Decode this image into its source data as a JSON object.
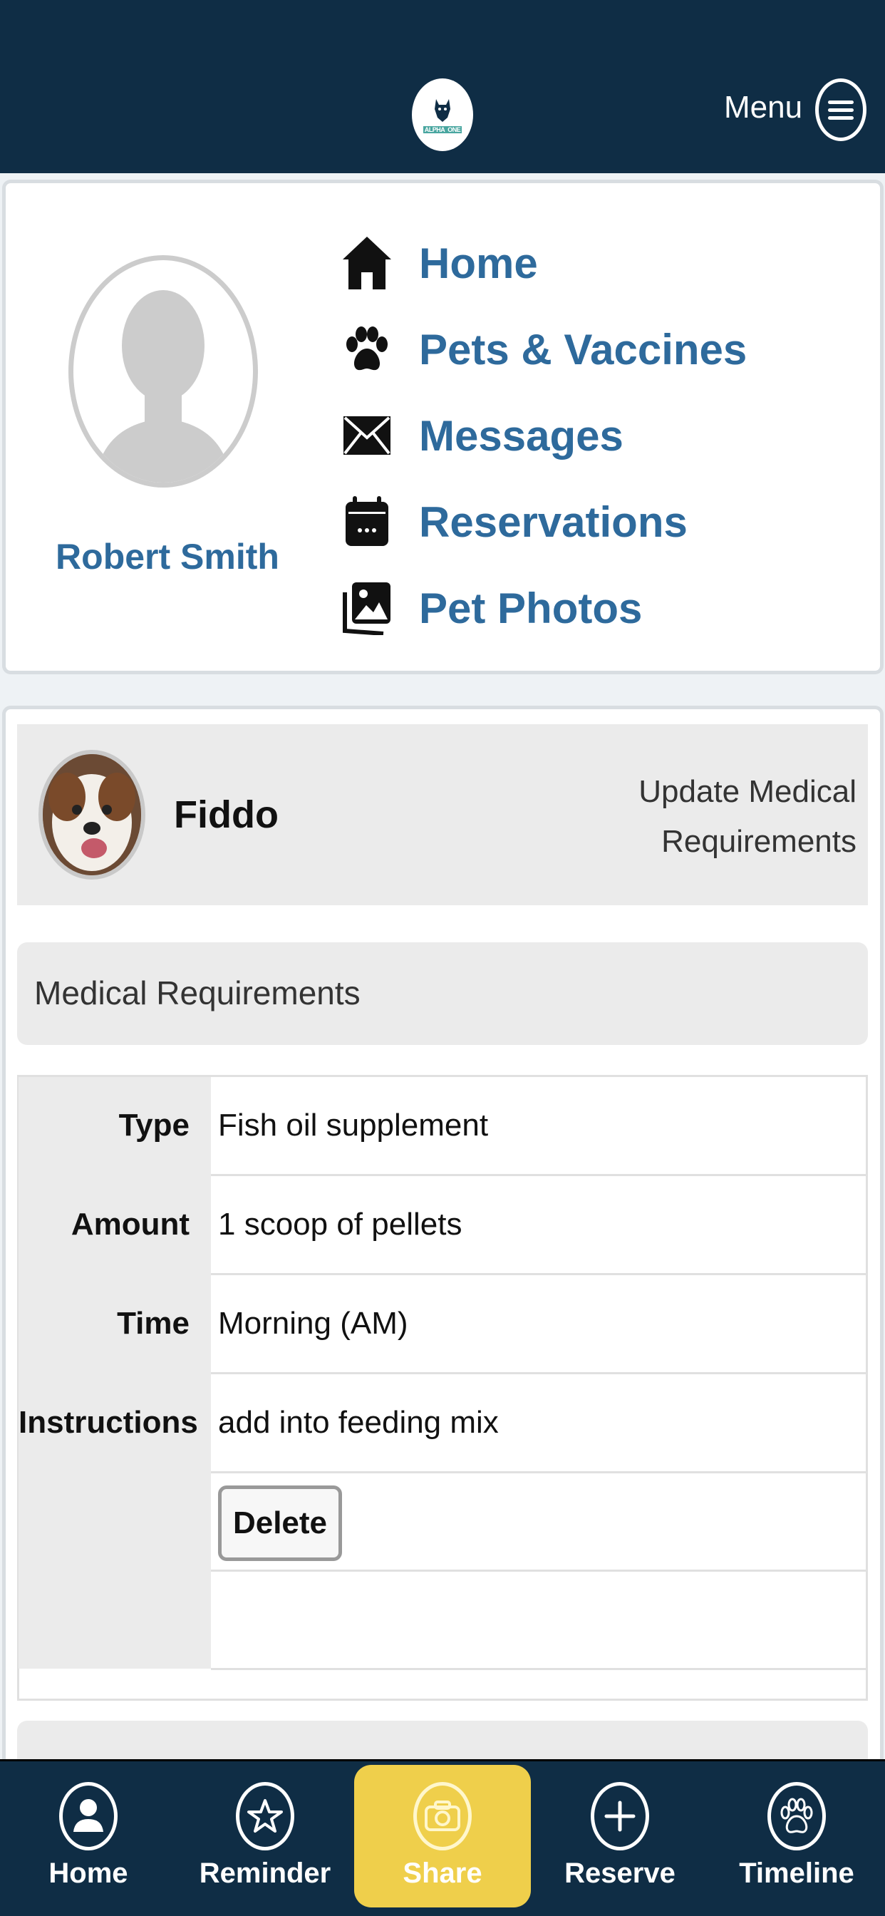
{
  "header": {
    "logo_text": "ALPHA",
    "logo_badge": "ONE",
    "menu_label": "Menu"
  },
  "profile": {
    "name": "Robert Smith"
  },
  "nav_menu": [
    {
      "label": "Home",
      "icon": "home-icon"
    },
    {
      "label": "Pets & Vaccines",
      "icon": "paw-icon"
    },
    {
      "label": "Messages",
      "icon": "envelope-icon"
    },
    {
      "label": "Reservations",
      "icon": "calendar-icon"
    },
    {
      "label": "Pet Photos",
      "icon": "photos-icon"
    }
  ],
  "pet": {
    "name": "Fiddo",
    "update_link": "Update Medical Requirements"
  },
  "medical": {
    "section_title": "Medical Requirements",
    "rows": [
      {
        "label": "Type",
        "value": "Fish oil supplement"
      },
      {
        "label": "Amount",
        "value": "1 scoop of pellets"
      },
      {
        "label": "Time",
        "value": "Morning (AM)"
      },
      {
        "label": "Instructions",
        "value": "add into feeding mix"
      }
    ],
    "delete_label": "Delete"
  },
  "bottom_nav": [
    {
      "label": "Home",
      "icon": "user-icon",
      "active": false
    },
    {
      "label": "Reminder",
      "icon": "star-icon",
      "active": false
    },
    {
      "label": "Share",
      "icon": "camera-icon",
      "active": true
    },
    {
      "label": "Reserve",
      "icon": "plus-icon",
      "active": false
    },
    {
      "label": "Timeline",
      "icon": "paw-icon",
      "active": false
    }
  ],
  "colors": {
    "header_bg": "#0f2d45",
    "link_blue": "#2e6a9c",
    "active_tab": "#efcf4b"
  }
}
